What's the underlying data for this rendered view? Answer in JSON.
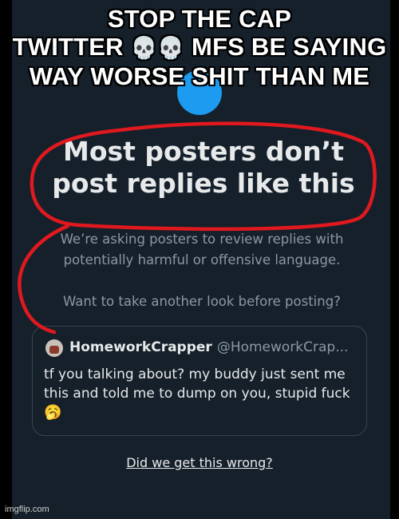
{
  "meme": {
    "line1": "STOP THE CAP",
    "line2_part1": "TWITTER",
    "line2_emoji": "💀💀",
    "line2_part2": "MFS BE SAYING",
    "line3": "WAY WORSE SHIT THAN ME"
  },
  "prompt": {
    "headline_line1": "Most posters don’t",
    "headline_line2": "post replies like this",
    "body_line1": "We’re asking posters to review replies with",
    "body_line2": "potentially harmful or offensive language.",
    "question": "Want to take another look before posting?"
  },
  "reply_card": {
    "display_name": "HomeworkCrapper",
    "username": "@HomeworkCrap...",
    "text": "tf you talking about? my buddy just sent me this and told me to dump on you, stupid fuck",
    "emoji": "🥱"
  },
  "feedback_link": "Did we get this wrong?",
  "watermark": "imgflip.com",
  "colors": {
    "background": "#15202b",
    "accent_blue": "#1d9bf0",
    "annotation_red": "#e0191f",
    "primary_text": "#e7e9ea",
    "secondary_text": "#8b98a5"
  }
}
